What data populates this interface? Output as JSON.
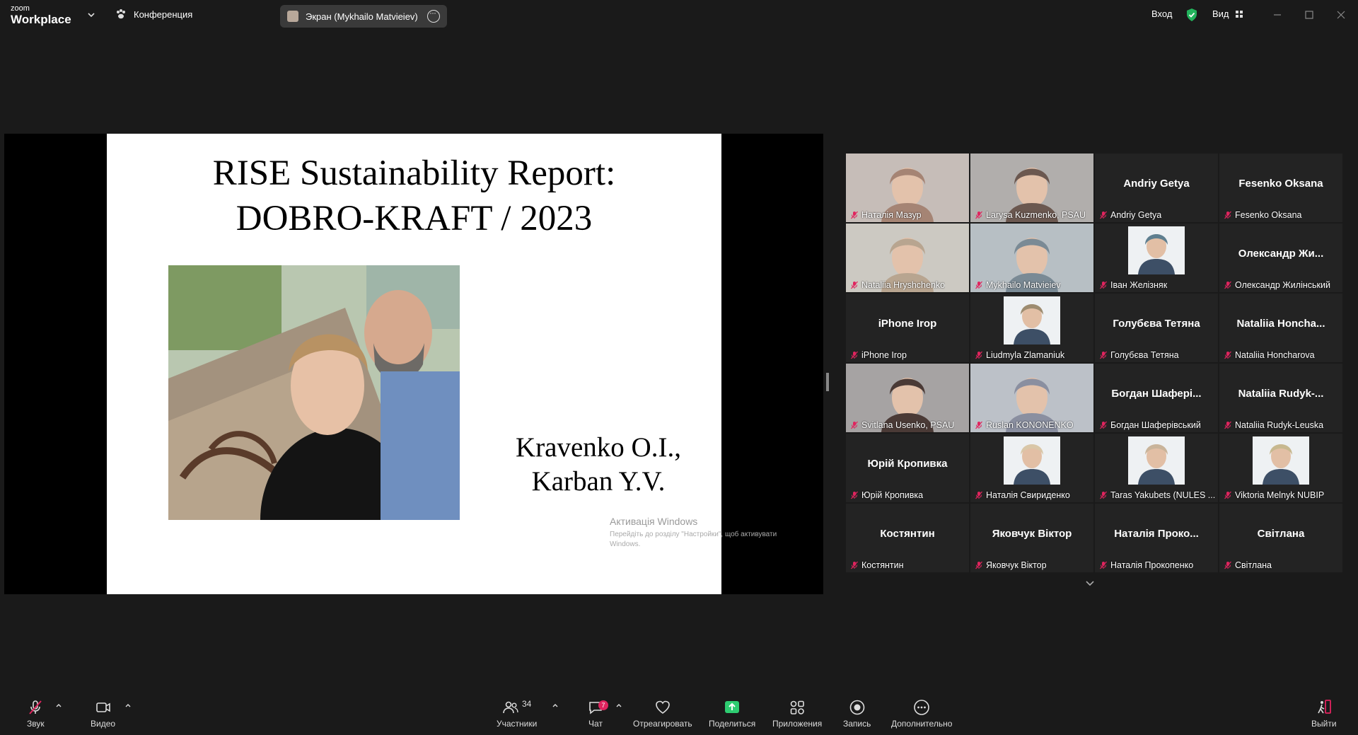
{
  "topbar": {
    "logo_small": "zoom",
    "logo_big": "Workplace",
    "conference_label": "Конференция",
    "screen_pill_label": "Экран (Mykhailo Matvieiev)",
    "login_label": "Вход",
    "view_label": "Вид"
  },
  "slide": {
    "title_line1": "RISE Sustainability Report:",
    "title_line2": "DOBRO-KRAFT / 2023",
    "authors_line1": "Kravenko O.I.,",
    "authors_line2": "Karban Y.V."
  },
  "activation": {
    "title": "Активація Windows",
    "subtitle": "Перейдіть до розділу \"Настройки\", щоб активувати Windows."
  },
  "participants": [
    {
      "name": "Наталія Мазур",
      "video": true,
      "tone": "#a58474"
    },
    {
      "name": "Larysa Kuzmenko, PSAU",
      "video": true,
      "tone": "#6b5850"
    },
    {
      "name": "Andriy Getya",
      "big": "Andriy Getya"
    },
    {
      "name": "Fesenko Oksana",
      "big": "Fesenko Oksana"
    },
    {
      "name": "Nataliia Hryshchenko",
      "video": true,
      "tone": "#b8a590"
    },
    {
      "name": "Mykhailo Matvieiev",
      "video": true,
      "active": true,
      "tone": "#7a8a95"
    },
    {
      "name": "Іван Желізняк",
      "thumb": true,
      "tone": "#5f7f8f"
    },
    {
      "name": "Олександр Жилінський",
      "big": "Олександр  Жи..."
    },
    {
      "name": "iPhone Irop",
      "big": "iPhone Irop"
    },
    {
      "name": "Liudmyla Zlamaniuk",
      "thumb": true,
      "tone": "#9d8c70"
    },
    {
      "name": "Голубєва Тетяна",
      "big": "Голубєва Тетяна"
    },
    {
      "name": "Nataliia Honcharova",
      "big": "Nataliia  Honcha..."
    },
    {
      "name": "Svitlana Usenko, PSAU",
      "video": true,
      "tone": "#4a3a36"
    },
    {
      "name": "Ruslan KONONENKO",
      "video": true,
      "tone": "#8a8fa0"
    },
    {
      "name": "Богдан Шаферівський",
      "big": "Богдан  Шафері..."
    },
    {
      "name": "Nataliia Rudyk-Leuska",
      "big": "Nataliia  Rudyk-..."
    },
    {
      "name": "Юрій Кропивка",
      "big": "Юрій Кропивка"
    },
    {
      "name": "Наталія Свириденко",
      "thumb": true,
      "tone": "#d9c7a8"
    },
    {
      "name": "Taras Yakubets (NULES ...",
      "thumb": true,
      "tone": "#c9b49a"
    },
    {
      "name": "Viktoria Melnyk NUBIP",
      "thumb": true,
      "tone": "#c7b88f"
    },
    {
      "name": "Костянтин",
      "big": "Костянтин"
    },
    {
      "name": "Яковчук Віктор",
      "big": "Яковчук Віктор"
    },
    {
      "name": "Наталія Прокопенко",
      "big": "Наталія  Проко..."
    },
    {
      "name": "Світлана",
      "big": "Світлана"
    }
  ],
  "toolbar": {
    "audio": "Звук",
    "video": "Видео",
    "participants": "Участники",
    "participants_count": "34",
    "chat": "Чат",
    "chat_badge": "7",
    "react": "Отреагировать",
    "share": "Поделиться",
    "apps": "Приложения",
    "record": "Запись",
    "more": "Дополнительно",
    "leave": "Выйти"
  }
}
